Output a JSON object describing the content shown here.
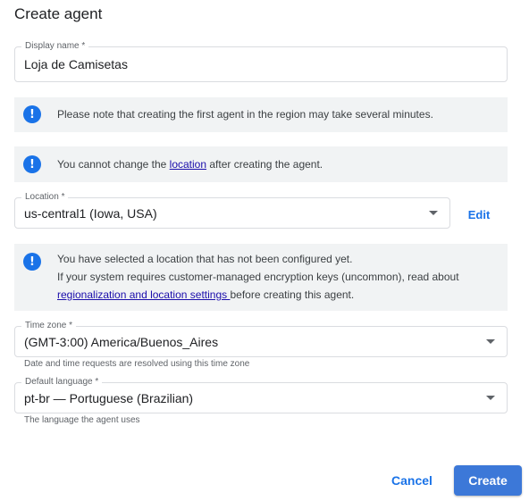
{
  "dialog": {
    "title": "Create agent"
  },
  "display_name": {
    "label": "Display name *",
    "value": "Loja de Camisetas"
  },
  "notes": {
    "first_agent": "Please note that creating the first agent in the region may take several minutes.",
    "location_warning": {
      "before": "You cannot change the ",
      "link": "location",
      "after": " after creating the agent."
    },
    "unconfigured": {
      "line1": "You have selected a location that has not been configured yet.",
      "line2": "If your system requires customer-managed encryption keys (uncommon), read about",
      "link": "regionalization and location settings ",
      "after": "before creating this agent."
    }
  },
  "location": {
    "label": "Location *",
    "value": "us-central1 (Iowa, USA)",
    "edit_label": "Edit"
  },
  "time_zone": {
    "label": "Time zone *",
    "value": "(GMT-3:00) America/Buenos_Aires",
    "hint": "Date and time requests are resolved using this time zone"
  },
  "default_language": {
    "label": "Default language *",
    "value": "pt-br — Portuguese (Brazilian)",
    "hint": "The language the agent uses"
  },
  "actions": {
    "cancel": "Cancel",
    "create": "Create"
  },
  "icons": {
    "info": "info-icon",
    "dropdown": "dropdown-arrow-icon"
  },
  "colors": {
    "accent": "#1a73e8",
    "primary_button": "#3c78d8",
    "note_bg": "#f1f3f4"
  }
}
